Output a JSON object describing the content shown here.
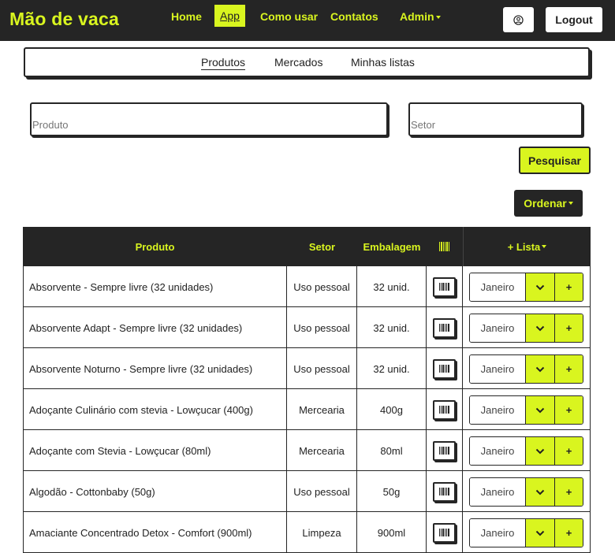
{
  "navbar": {
    "brand": "Mão de vaca",
    "links": {
      "home": "Home",
      "app": "App",
      "como_usar": "Como usar",
      "contatos": "Contatos",
      "admin": "Admin"
    },
    "logout": "Logout"
  },
  "tabs": {
    "produtos": "Produtos",
    "mercados": "Mercados",
    "minhas_listas": "Minhas listas"
  },
  "search": {
    "produto_placeholder": "Produto",
    "setor_placeholder": "Setor",
    "search_button": "Pesquisar",
    "order_button": "Ordenar"
  },
  "table": {
    "headers": {
      "produto": "Produto",
      "setor": "Setor",
      "embalagem": "Embalagem",
      "lista": "+ Lista"
    },
    "rows": [
      {
        "name": "Absorvente - Sempre livre (32 unidades)",
        "setor": "Uso pessoal",
        "emb": "32 unid.",
        "month": "Janeiro",
        "add": "+"
      },
      {
        "name": "Absorvente Adapt - Sempre livre (32 unidades)",
        "setor": "Uso pessoal",
        "emb": "32 unid.",
        "month": "Janeiro",
        "add": "+"
      },
      {
        "name": "Absorvente Noturno - Sempre livre (32 unidades)",
        "setor": "Uso pessoal",
        "emb": "32 unid.",
        "month": "Janeiro",
        "add": "+"
      },
      {
        "name": "Adoçante Culinário com stevia - Lowçucar (400g)",
        "setor": "Mercearia",
        "emb": "400g",
        "month": "Janeiro",
        "add": "+"
      },
      {
        "name": "Adoçante com Stevia - Lowçucar (80ml)",
        "setor": "Mercearia",
        "emb": "80ml",
        "month": "Janeiro",
        "add": "+"
      },
      {
        "name": "Algodão - Cottonbaby (50g)",
        "setor": "Uso pessoal",
        "emb": "50g",
        "month": "Janeiro",
        "add": "+"
      },
      {
        "name": "Amaciante Concentrado Detox - Comfort (900ml)",
        "setor": "Limpeza",
        "emb": "900ml",
        "month": "Janeiro",
        "add": "+"
      }
    ]
  },
  "colors": {
    "accent": "#d9f51f",
    "dark": "#252525"
  }
}
